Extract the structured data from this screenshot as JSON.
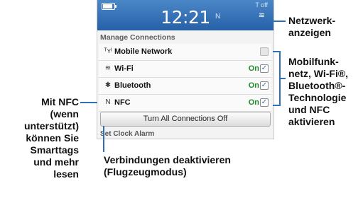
{
  "status_bar": {
    "time": "12:21",
    "nfc_indicator": "N",
    "toff_label": "T off",
    "battery_level": 0.85,
    "wifi_icon": "wifi-icon",
    "battery_icon": "battery-icon"
  },
  "section_header": "Manage Connections",
  "connections": [
    {
      "name": "mobile",
      "label": "Mobile Network",
      "icon": "mobile-network-icon",
      "glyph": "ᵀʏᴵ",
      "state": "",
      "checked": false
    },
    {
      "name": "wifi",
      "label": "Wi-Fi",
      "icon": "wifi-icon",
      "glyph": "≋",
      "state": "On",
      "checked": true
    },
    {
      "name": "bluetooth",
      "label": "Bluetooth",
      "icon": "bluetooth-icon",
      "glyph": "✱",
      "state": "On",
      "checked": true
    },
    {
      "name": "nfc",
      "label": "NFC",
      "icon": "nfc-icon",
      "glyph": "N",
      "state": "On",
      "checked": true
    }
  ],
  "all_off_button": "Turn All Connections Off",
  "next_section": "Set Clock Alarm",
  "callouts": {
    "network_indicators": "Netzwerk-\nanzeigen",
    "enable_radios": "Mobilfunk-\nnetz, Wi-Fi®,\nBluetooth®-\nTechnologie\nund NFC\naktivieren",
    "nfc_note": "Mit NFC\n(wenn\nunterstützt)\nkönnen Sie\nSmarttags\nund mehr\nlesen",
    "airplane_mode": "Verbindungen deaktivieren\n(Flugzeugmodus)"
  },
  "colors": {
    "status_bar": "#2f6db3",
    "callout_line": "#2e6fb5",
    "on_text": "#1d8a2b"
  }
}
